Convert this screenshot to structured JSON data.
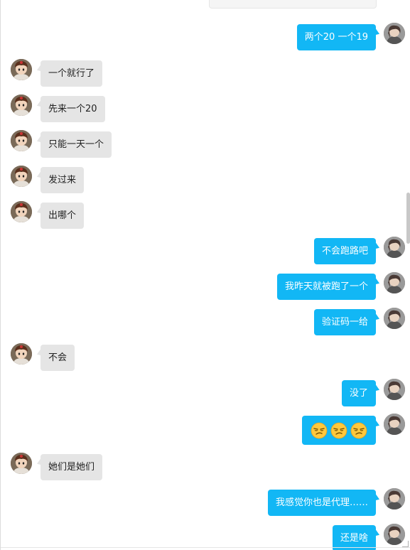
{
  "colors": {
    "sent_bubble": "#12b7f5",
    "received_bubble": "#e5e5e5",
    "background": "#ffffff"
  },
  "icons": {
    "contact_avatar": "cartoon-avatar-icon",
    "self_avatar": "user-avatar-icon",
    "emoji": "smirk-emoji-icon"
  },
  "messages": [
    {
      "side": "right",
      "text": "两个20 一个19"
    },
    {
      "side": "left",
      "text": "一个就行了"
    },
    {
      "side": "left",
      "text": "先来一个20"
    },
    {
      "side": "left",
      "text": "只能一天一个"
    },
    {
      "side": "left",
      "text": "发过来"
    },
    {
      "side": "left",
      "text": "出哪个"
    },
    {
      "side": "right",
      "text": "不会跑路吧"
    },
    {
      "side": "right",
      "text": "我昨天就被跑了一个"
    },
    {
      "side": "right",
      "text": "验证码一给"
    },
    {
      "side": "left",
      "text": "不会"
    },
    {
      "side": "right",
      "text": "没了"
    },
    {
      "side": "right",
      "emoji_count": 3
    },
    {
      "side": "left",
      "text": "她们是她们"
    },
    {
      "side": "right",
      "text": "我感觉你也是代理……"
    },
    {
      "side": "right",
      "text": "还是啥"
    }
  ]
}
